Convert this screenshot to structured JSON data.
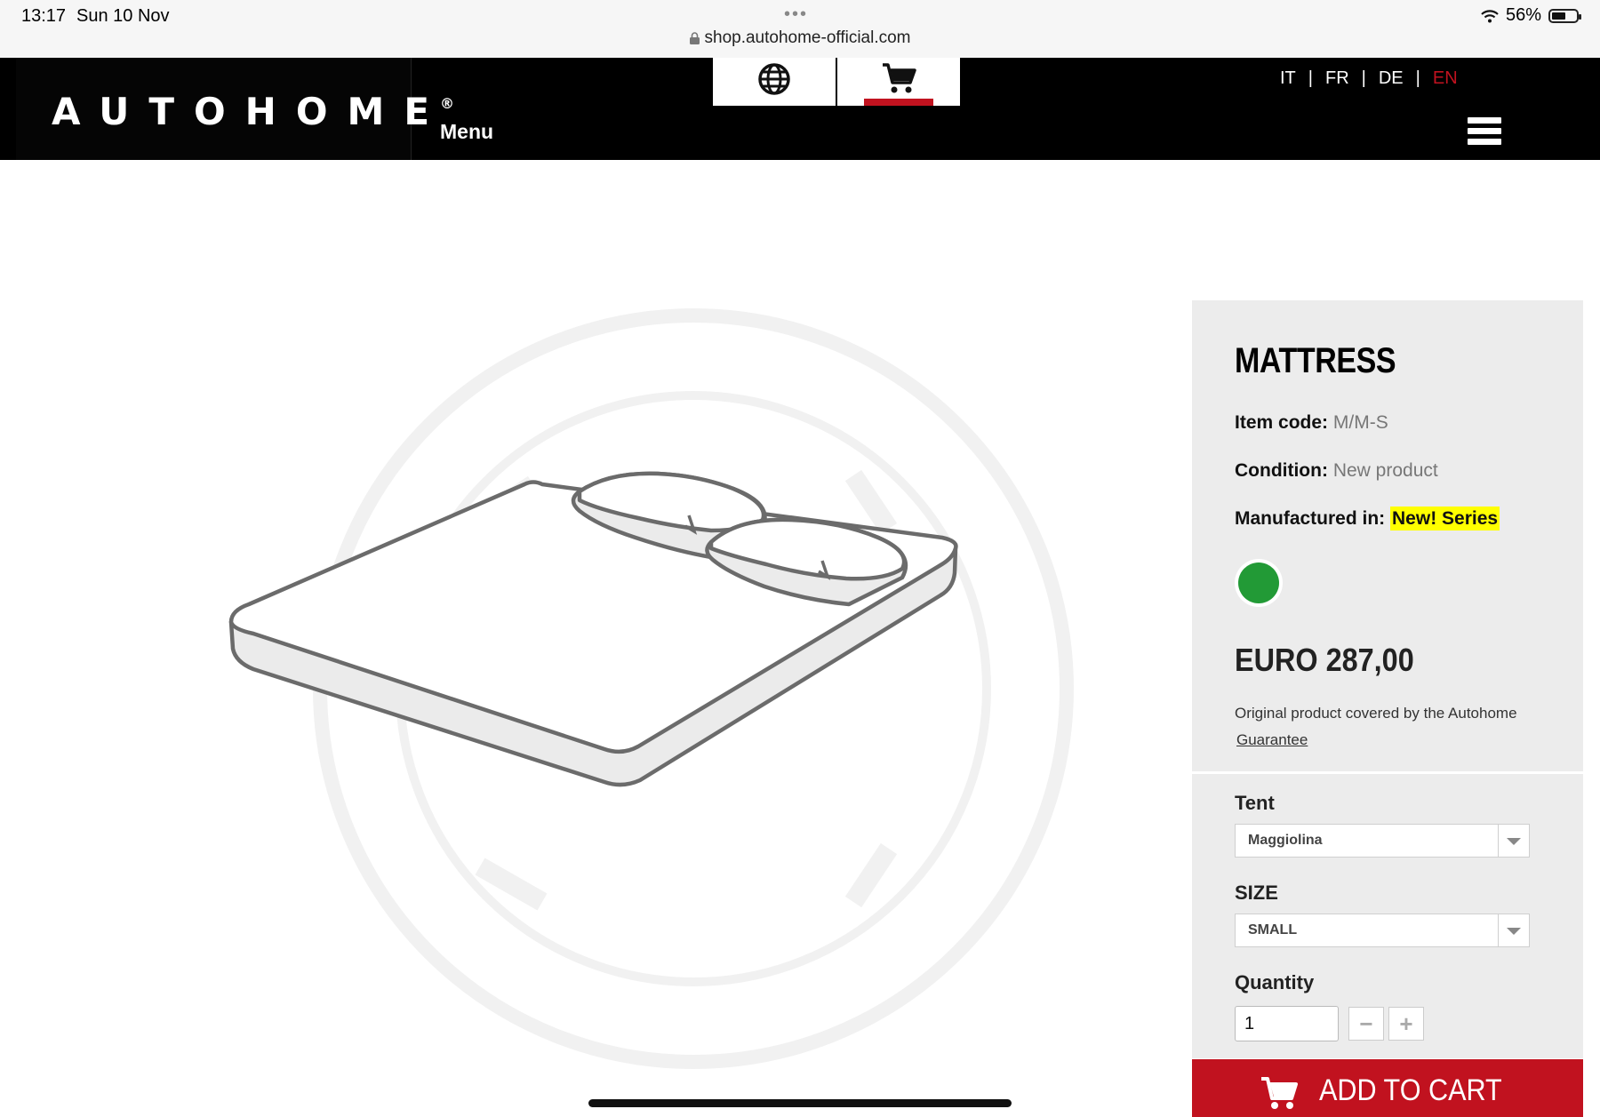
{
  "statusbar": {
    "time": "13:17",
    "date": "Sun 10 Nov",
    "url": "shop.autohome-official.com",
    "battery": "56%",
    "battery_level": 0.56
  },
  "header": {
    "logo": "AUTOHOME",
    "logo_mark": "®",
    "menu_label": "Menu",
    "languages": [
      "IT",
      "FR",
      "DE",
      "EN"
    ],
    "active_language": "EN",
    "accent": "#c1121f",
    "icons": [
      "globe-icon",
      "cart-icon",
      "hamburger-icon"
    ]
  },
  "product": {
    "title": "MATTRESS",
    "item_code_label": "Item code:",
    "item_code": "M/M-S",
    "condition_label": "Condition:",
    "condition": "New product",
    "manufactured_label": "Manufactured in:",
    "manufactured": "New! Series",
    "color_swatch": "#229a36",
    "price": "EURO 287,00",
    "note": "Original product covered by the Autohome",
    "guarantee_link": "Guarantee"
  },
  "options": {
    "tent_label": "Tent",
    "tent_value": "Maggiolina",
    "size_label": "SIZE",
    "size_value": "SMALL",
    "quantity_label": "Quantity",
    "quantity_value": "1",
    "minus": "−",
    "plus": "+"
  },
  "cart_button": {
    "label": "ADD TO CART"
  }
}
